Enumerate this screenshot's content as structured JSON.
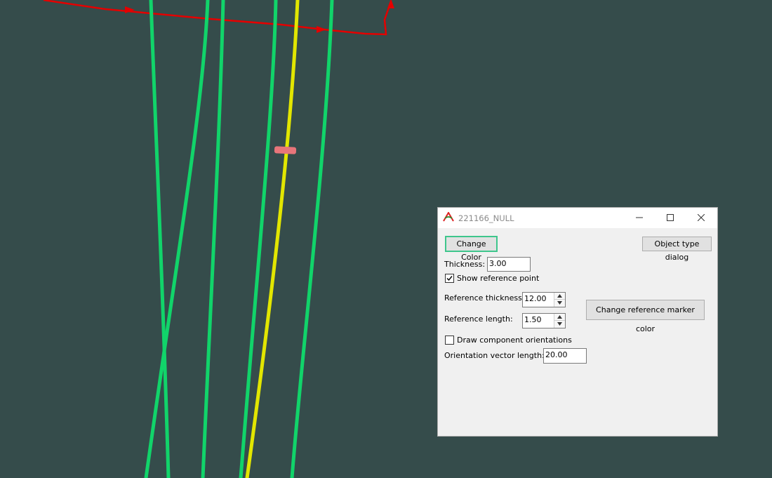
{
  "dialog": {
    "title": "221166_NULL",
    "change_color_label": "Change Color",
    "object_type_label": "Object type dialog",
    "thickness": {
      "label": "Thickness:",
      "value": "3.00"
    },
    "show_reference_point": {
      "label": "Show reference point",
      "checked": true
    },
    "reference_thickness": {
      "label": "Reference thickness:",
      "value": "12.00"
    },
    "reference_length": {
      "label": "Reference length:",
      "value": "1.50"
    },
    "change_marker_label": "Change reference marker color",
    "draw_orientations": {
      "label": "Draw component orientations",
      "checked": false
    },
    "orientation_length": {
      "label": "Orientation vector length:",
      "value": "20.00"
    }
  },
  "colors": {
    "background": "#354c4b",
    "path_green": "#11d46a",
    "path_yellow": "#e2e600",
    "path_red": "#e40000",
    "marker": "#e8757a",
    "focus_border": "#3ec68c"
  },
  "icons": {
    "app": "app-logo-icon",
    "minimize": "minimize-icon",
    "maximize": "maximize-icon",
    "close": "close-icon"
  }
}
